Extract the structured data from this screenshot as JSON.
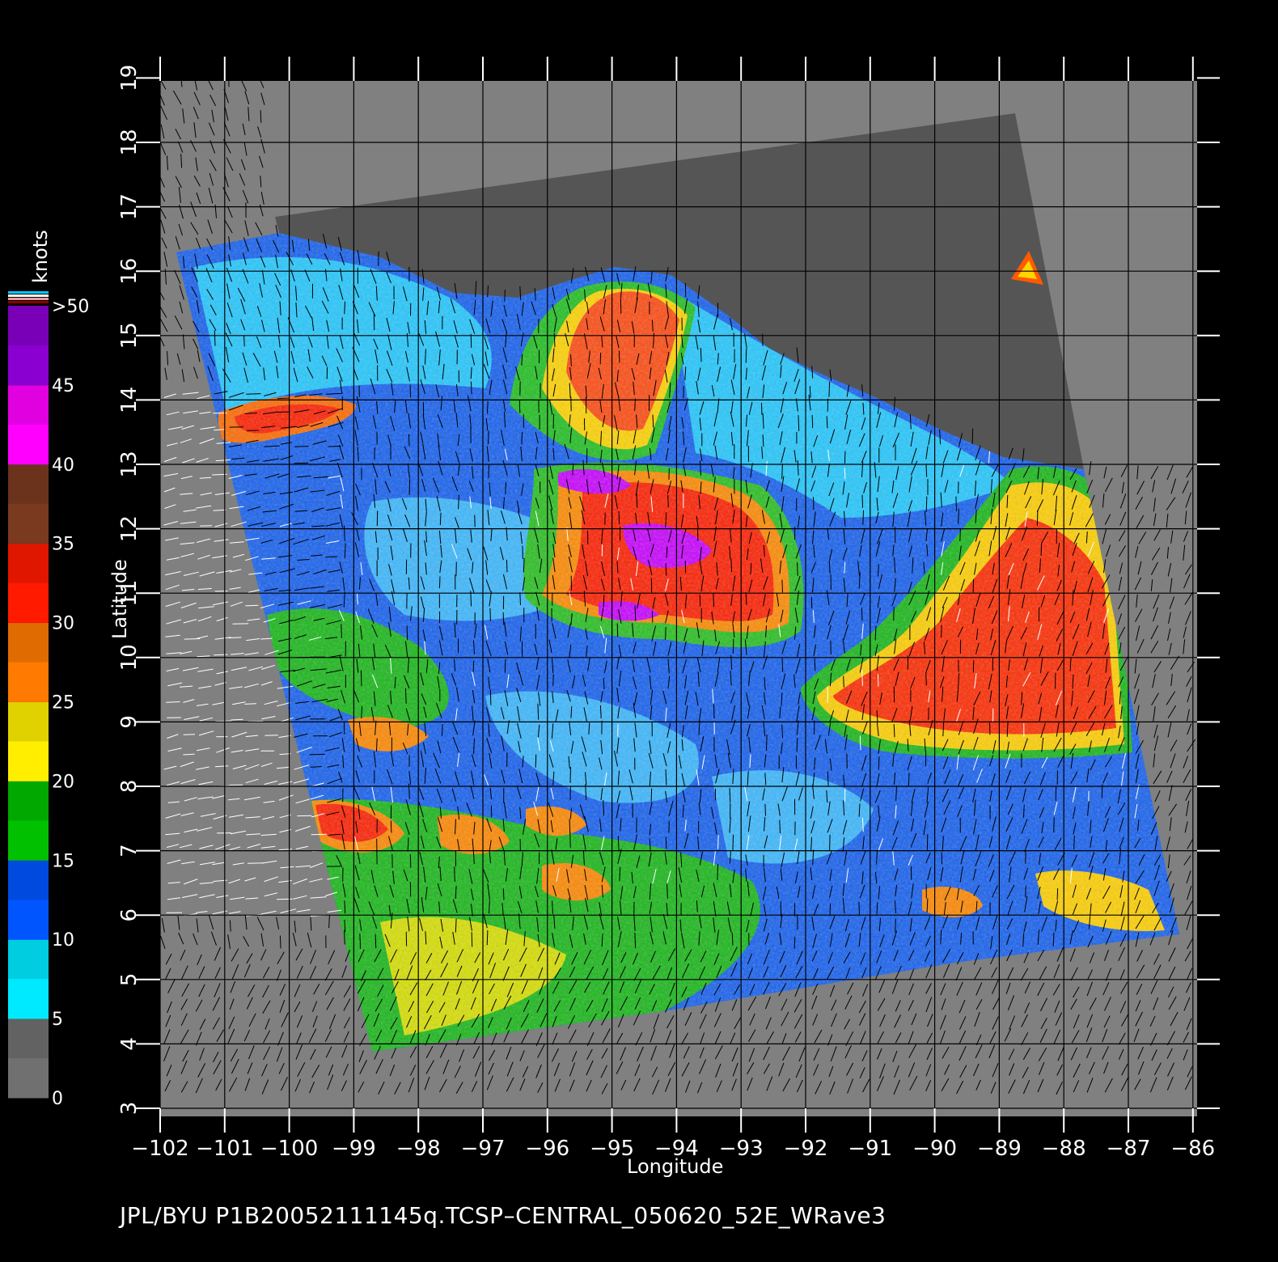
{
  "map": {
    "x_axis_title": "Longitude",
    "y_axis_title": "Latitude",
    "lon_ticks": [
      "−102",
      "−101",
      "−100",
      "−99",
      "−98",
      "−97",
      "−96",
      "−95",
      "−94",
      "−93",
      "−92",
      "−91",
      "−90",
      "−89",
      "−88",
      "−87",
      "−86"
    ],
    "lat_ticks": [
      "3",
      "4",
      "5",
      "6",
      "7",
      "8",
      "9",
      "10",
      "11",
      "12",
      "13",
      "14",
      "15",
      "16",
      "17",
      "18",
      "19"
    ],
    "lon_range": [
      -102,
      -86
    ],
    "lat_range": [
      3,
      19
    ]
  },
  "colorbar": {
    "title": "knots",
    "labels": [
      "0",
      "5",
      "10",
      "15",
      "20",
      "25",
      "30",
      "35",
      "40",
      "45",
      ">50"
    ],
    "colors": {
      "0-5": "#707070",
      "5-10": "#00eaff",
      "10-15": "#0055ff",
      "15-20": "#00c000",
      "20-25": "#ffee00",
      "25-30": "#ff7a00",
      "30-35": "#ff1a00",
      "35-40": "#7a3a20",
      "40-45": "#ff00ff",
      "45-50": "#8a00d0"
    }
  },
  "footer": {
    "caption": "JPL/BYU  P1B20052111145q.TCSP–CENTRAL_050620_52E_WRave3"
  },
  "colors": {
    "background": "#000000",
    "no_data": "#808080",
    "land": "#555555",
    "grid": "#000000"
  }
}
